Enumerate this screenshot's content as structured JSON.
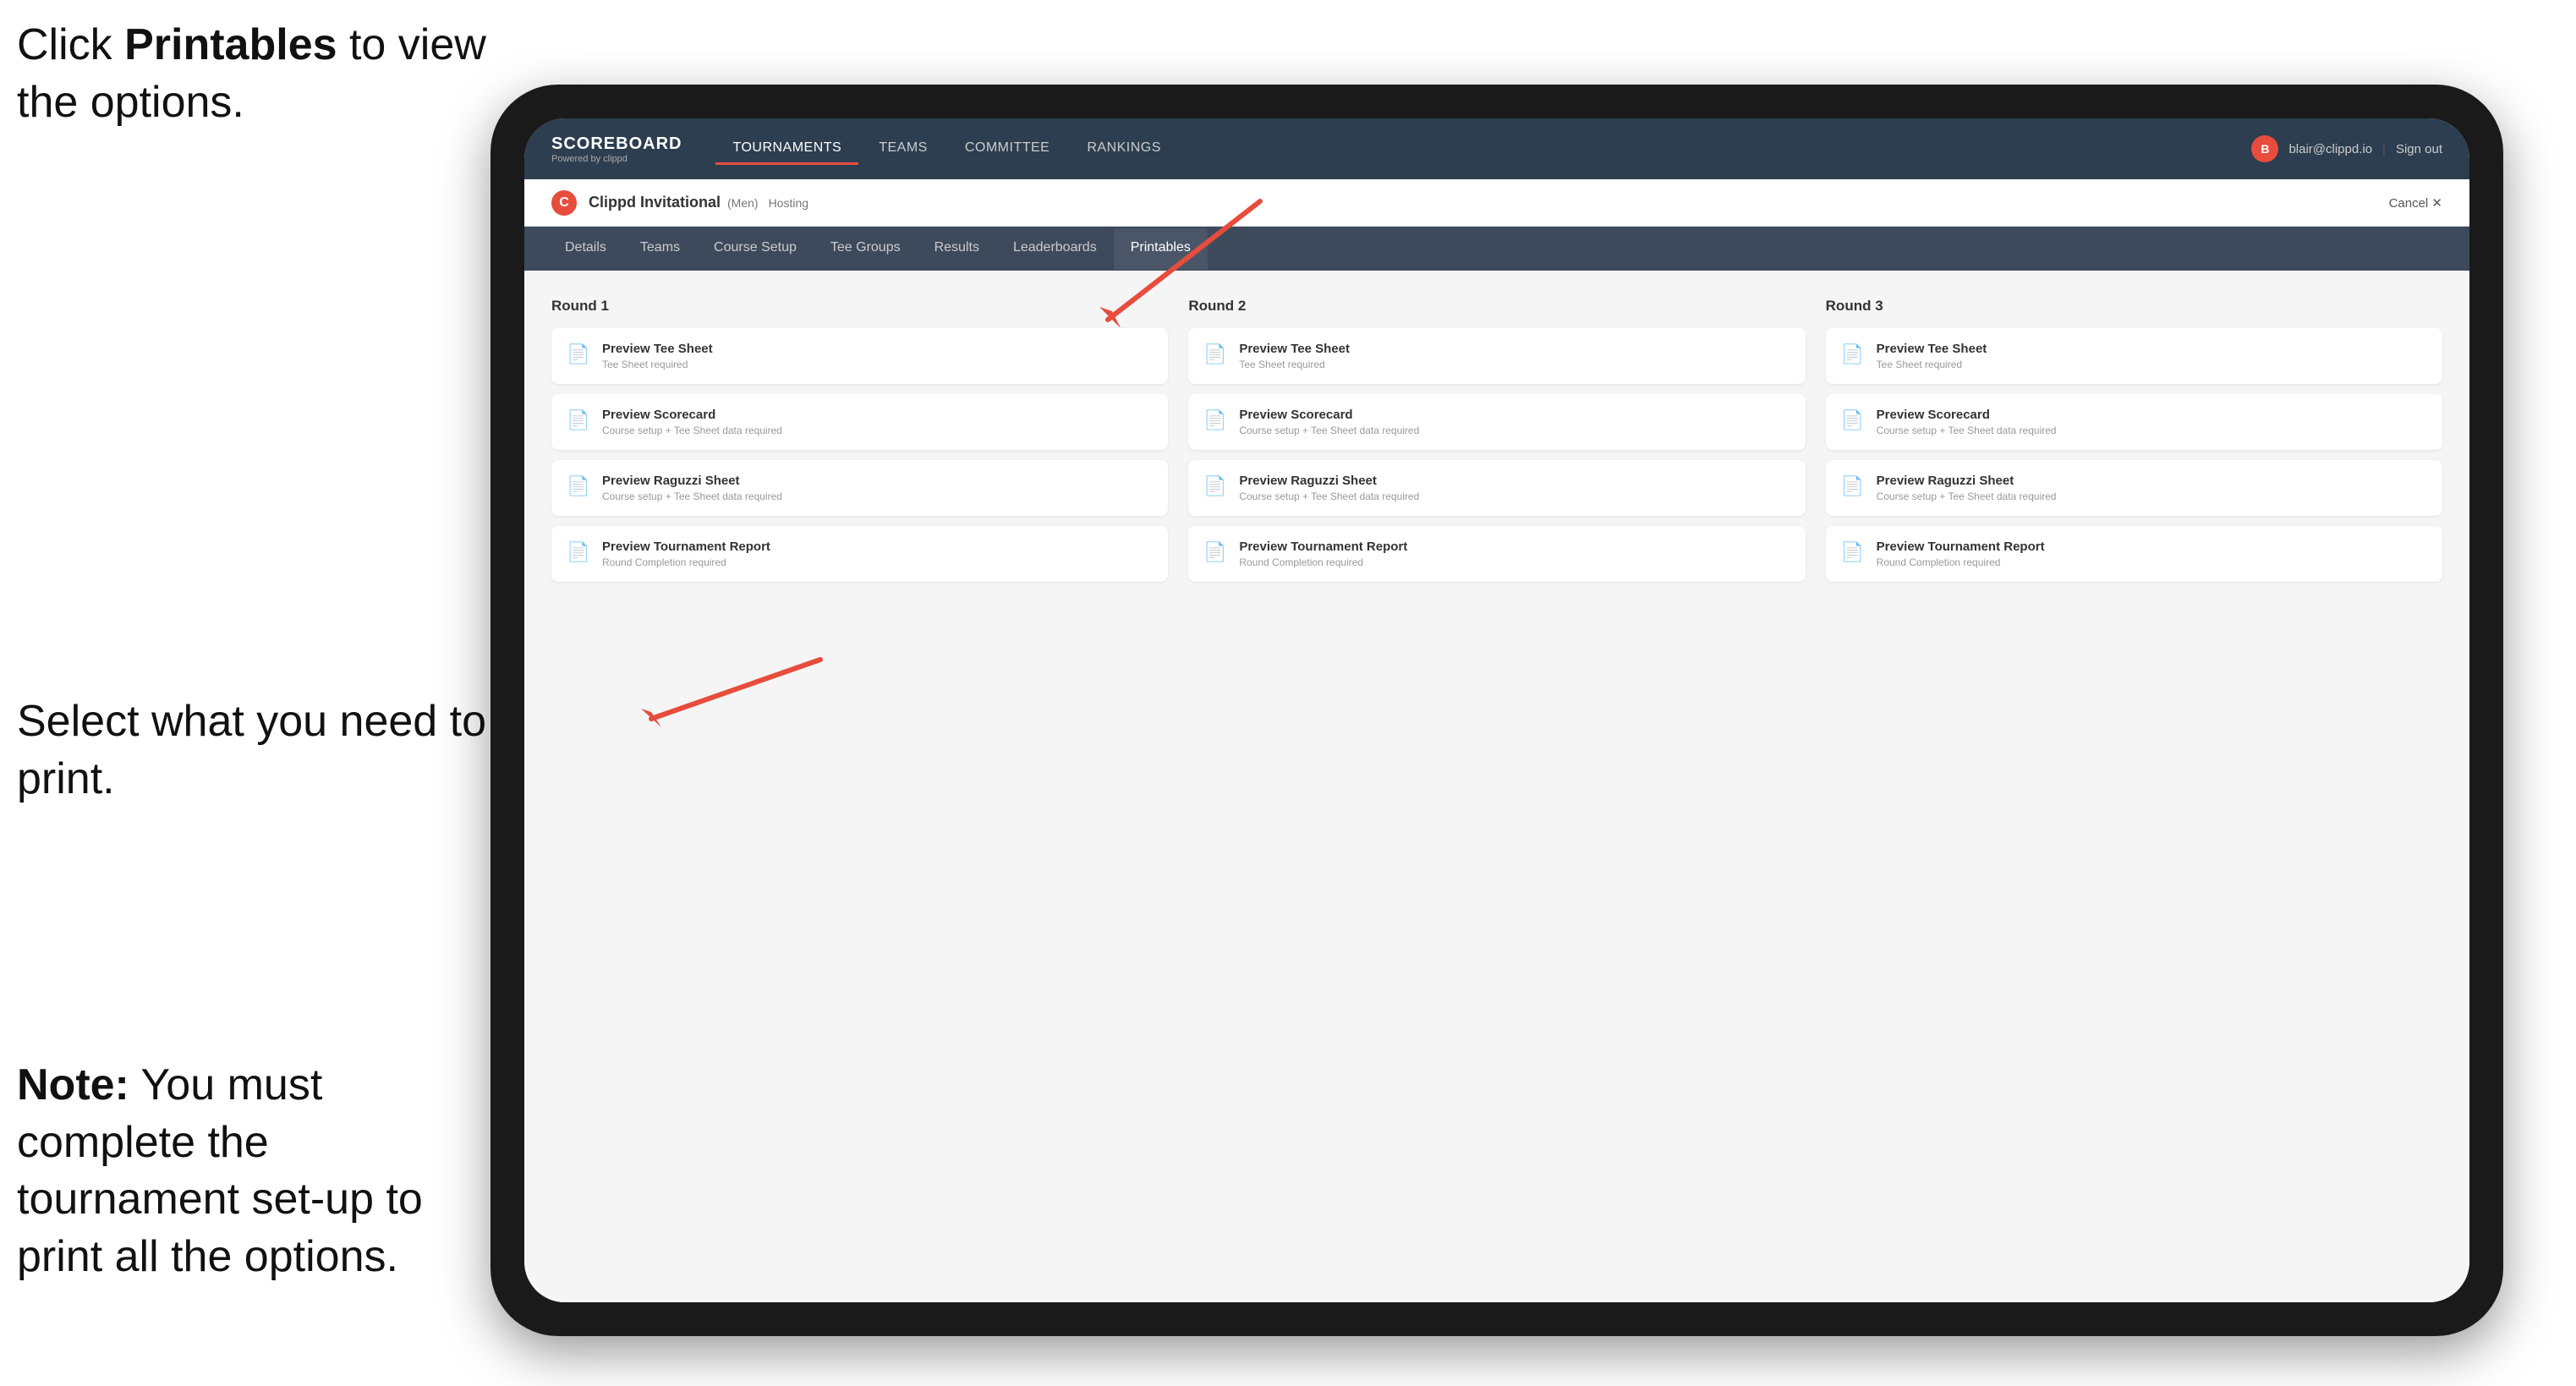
{
  "instructions": {
    "top": "Click ",
    "top_bold": "Printables",
    "top_rest": " to view the options.",
    "middle": "Select what you need to print.",
    "bottom_bold": "Note:",
    "bottom_rest": " You must complete the tournament set-up to print all the options."
  },
  "nav": {
    "logo": "SCOREBOARD",
    "logo_sub": "Powered by clippd",
    "items": [
      "TOURNAMENTS",
      "TEAMS",
      "COMMITTEE",
      "RANKINGS"
    ],
    "user_email": "blair@clippd.io",
    "sign_out": "Sign out"
  },
  "tournament": {
    "name": "Clippd Invitational",
    "tag": "(Men)",
    "status": "Hosting",
    "cancel": "Cancel ✕"
  },
  "tabs": {
    "items": [
      "Details",
      "Teams",
      "Course Setup",
      "Tee Groups",
      "Results",
      "Leaderboards",
      "Printables"
    ],
    "active": "Printables"
  },
  "rounds": [
    {
      "title": "Round 1",
      "cards": [
        {
          "title": "Preview Tee Sheet",
          "subtitle": "Tee Sheet required"
        },
        {
          "title": "Preview Scorecard",
          "subtitle": "Course setup + Tee Sheet data required"
        },
        {
          "title": "Preview Raguzzi Sheet",
          "subtitle": "Course setup + Tee Sheet data required"
        },
        {
          "title": "Preview Tournament Report",
          "subtitle": "Round Completion required"
        }
      ]
    },
    {
      "title": "Round 2",
      "cards": [
        {
          "title": "Preview Tee Sheet",
          "subtitle": "Tee Sheet required"
        },
        {
          "title": "Preview Scorecard",
          "subtitle": "Course setup + Tee Sheet data required"
        },
        {
          "title": "Preview Raguzzi Sheet",
          "subtitle": "Course setup + Tee Sheet data required"
        },
        {
          "title": "Preview Tournament Report",
          "subtitle": "Round Completion required"
        }
      ]
    },
    {
      "title": "Round 3",
      "cards": [
        {
          "title": "Preview Tee Sheet",
          "subtitle": "Tee Sheet required"
        },
        {
          "title": "Preview Scorecard",
          "subtitle": "Course setup + Tee Sheet data required"
        },
        {
          "title": "Preview Raguzzi Sheet",
          "subtitle": "Course setup + Tee Sheet data required"
        },
        {
          "title": "Preview Tournament Report",
          "subtitle": "Round Completion required"
        }
      ]
    }
  ]
}
